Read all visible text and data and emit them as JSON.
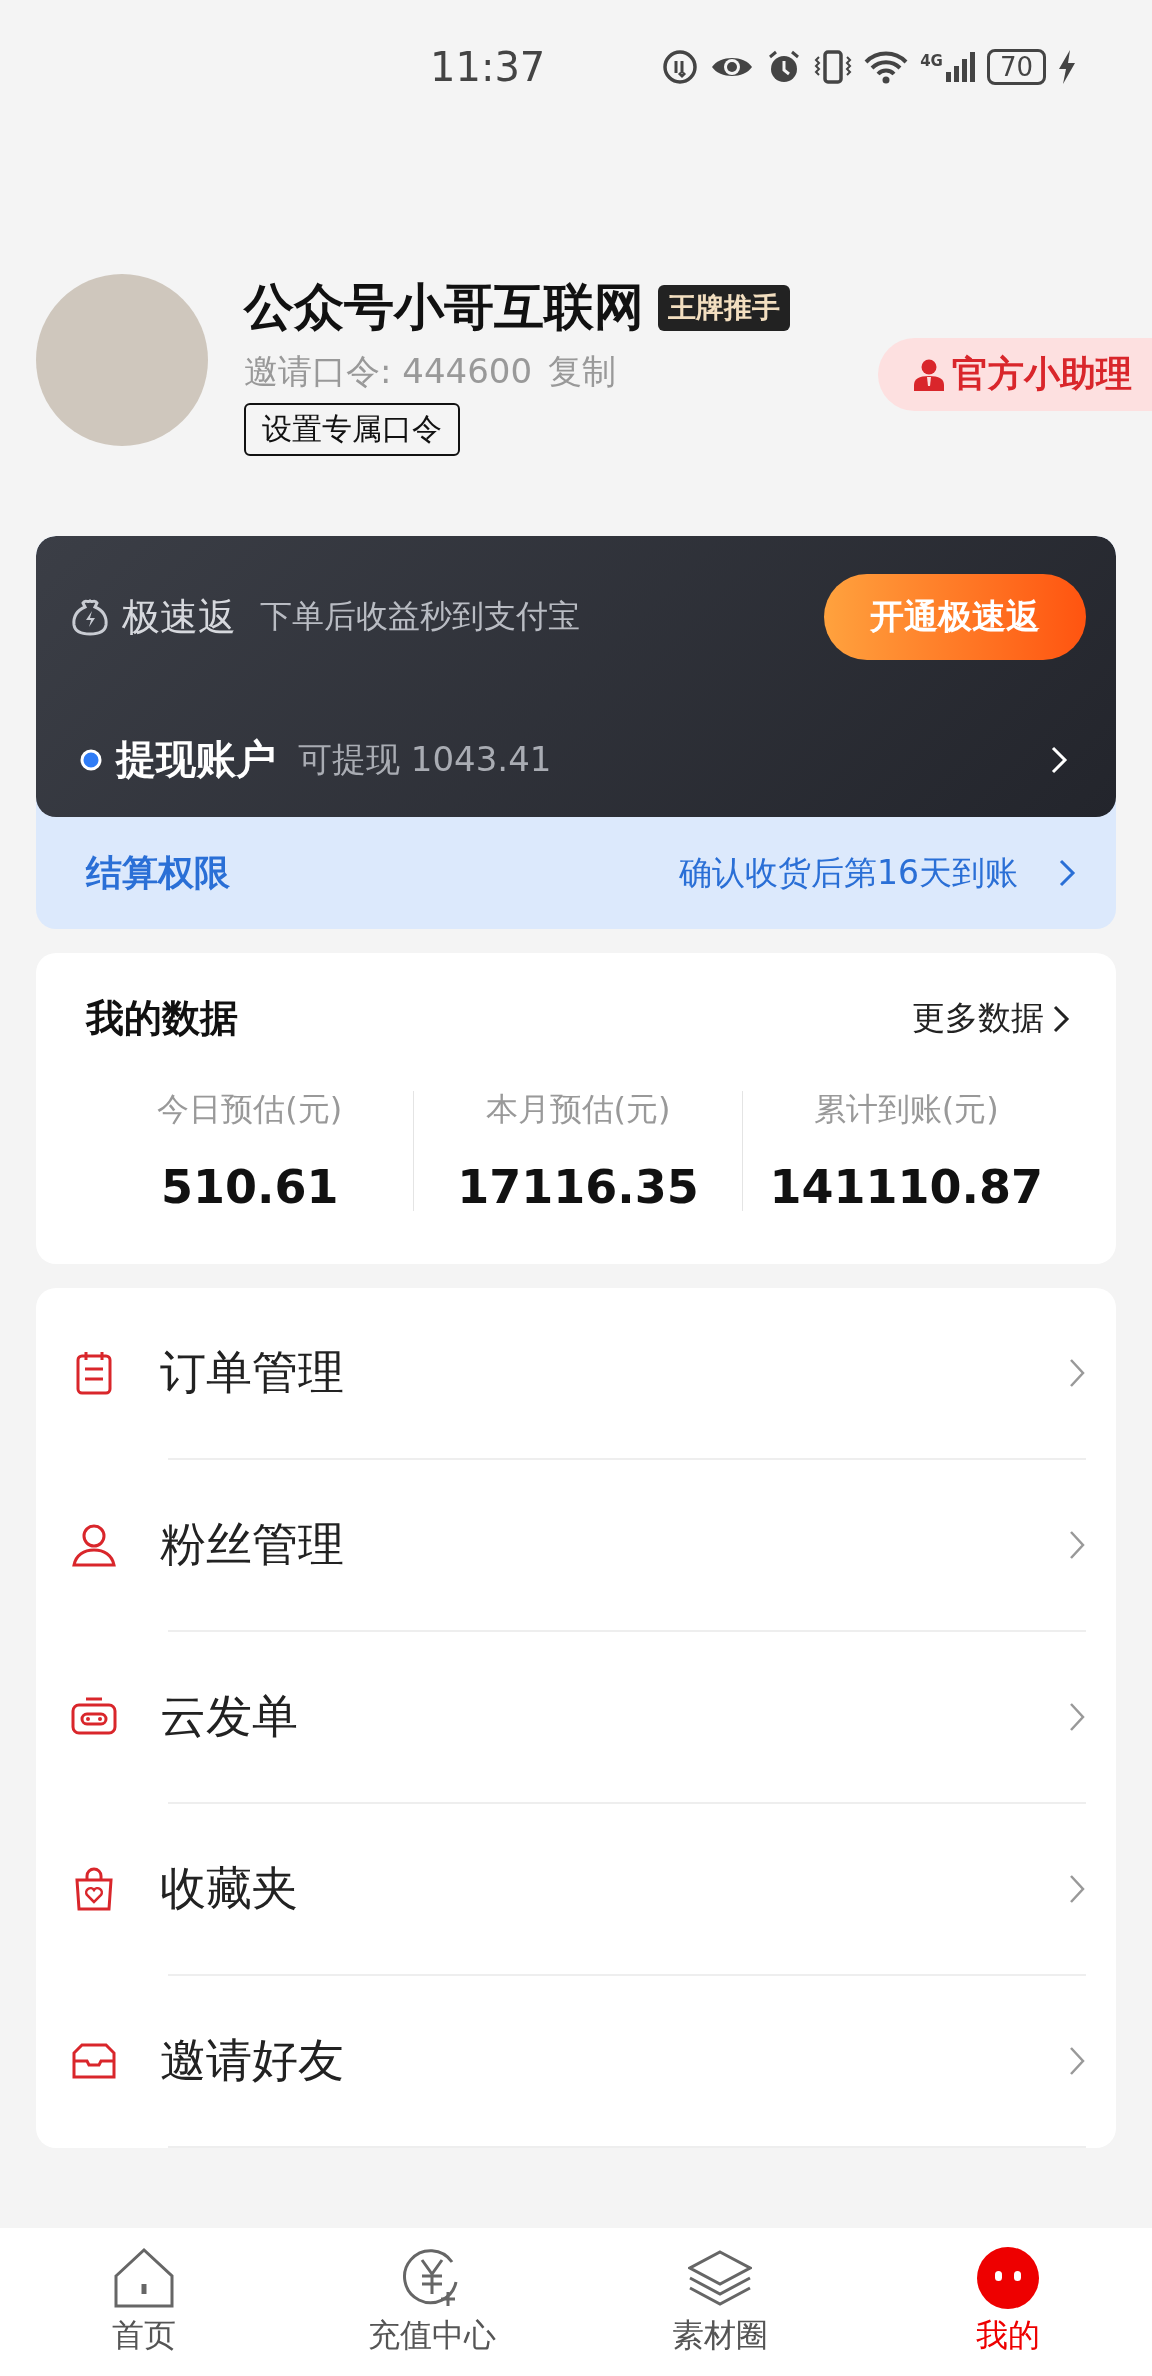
{
  "status_bar": {
    "time": "11:37",
    "network": "4G",
    "battery": "70"
  },
  "profile": {
    "name": "公众号小哥互联网",
    "badge": "王牌推手",
    "invite_label": "邀请口令: 444600",
    "copy": "复制",
    "set_code_button": "设置专属口令",
    "helper_button": "官方小助理"
  },
  "fast_return": {
    "title": "极速返",
    "subtitle": "下单后收益秒到支付宝",
    "button": "开通极速返"
  },
  "withdraw": {
    "title": "提现账户",
    "amount": "可提现 1043.41"
  },
  "settlement": {
    "title": "结算权限",
    "note": "确认收货后第16天到账"
  },
  "my_data": {
    "title": "我的数据",
    "more": "更多数据",
    "stats": [
      {
        "label": "今日预估(元)",
        "value": "510.61"
      },
      {
        "label": "本月预估(元)",
        "value": "17116.35"
      },
      {
        "label": "累计到账(元)",
        "value": "141110.87"
      }
    ]
  },
  "menu": [
    {
      "kind": "order",
      "label": "订单管理"
    },
    {
      "kind": "fans",
      "label": "粉丝管理"
    },
    {
      "kind": "cloud",
      "label": "云发单"
    },
    {
      "kind": "favorite",
      "label": "收藏夹"
    },
    {
      "kind": "invite",
      "label": "邀请好友"
    }
  ],
  "tab_bar": [
    {
      "kind": "home",
      "label": "首页",
      "selected": false
    },
    {
      "kind": "recharge",
      "label": "充值中心",
      "selected": false
    },
    {
      "kind": "material",
      "label": "素材圈",
      "selected": false
    },
    {
      "kind": "mine",
      "label": "我的",
      "selected": true
    }
  ]
}
